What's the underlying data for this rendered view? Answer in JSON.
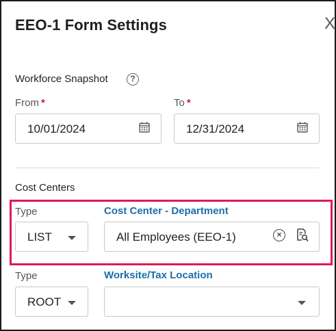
{
  "dialog": {
    "title": "EEO-1 Form Settings",
    "close_glyph": "X"
  },
  "workforce_snapshot": {
    "label": "Workforce Snapshot",
    "help_glyph": "?",
    "from": {
      "label": "From",
      "required": "*",
      "value": "10/01/2024"
    },
    "to": {
      "label": "To",
      "required": "*",
      "value": "12/31/2024"
    }
  },
  "cost_centers": {
    "label": "Cost Centers",
    "row1": {
      "type_label": "Type",
      "type_value": "LIST",
      "target_label": "Cost Center - Department",
      "target_value": "All Employees (EEO-1)",
      "clear_glyph": "×"
    },
    "row2": {
      "type_label": "Type",
      "type_value": "ROOT",
      "target_label": "Worksite/Tax Location",
      "target_value": ""
    }
  },
  "colors": {
    "accent_link": "#1b6ea8",
    "required": "#c81f2d",
    "highlight_border": "#e0195a"
  },
  "icons": [
    "close-icon",
    "help-icon",
    "calendar-icon",
    "chevron-down-icon",
    "clear-icon",
    "lookup-icon"
  ]
}
